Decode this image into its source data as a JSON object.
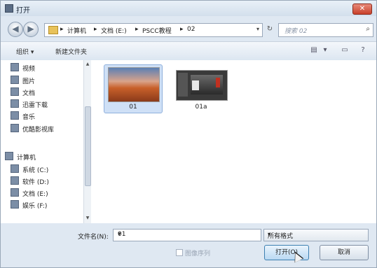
{
  "window": {
    "title": "打开",
    "close_glyph": "✕"
  },
  "address_bar": {
    "back_glyph": "◀",
    "forward_glyph": "▶",
    "breadcrumbs": [
      "计算机",
      "文档 (E:)",
      "PSCC教程",
      "02"
    ],
    "separator": "▸",
    "dropdown_glyph": "▾",
    "refresh_glyph": "↻",
    "search_placeholder": "搜索 02",
    "search_icon_glyph": "⌕"
  },
  "toolbar": {
    "organize_label": "组织 ▾",
    "new_folder_label": "新建文件夹",
    "view_icon_glyph": "▤",
    "view_dropdown_glyph": "▾",
    "preview_icon_glyph": "▭",
    "help_icon_glyph": "?"
  },
  "navigation": {
    "libraries": [
      "视频",
      "图片",
      "文档",
      "迅雷下载",
      "音乐",
      "优酷影视库"
    ],
    "computer_label": "计算机",
    "drives": [
      "系统 (C:)",
      "软件 (D:)",
      "文档 (E:)",
      "娱乐 (F:)"
    ],
    "scroll_up_glyph": "▲",
    "scroll_down_glyph": "▼"
  },
  "files": [
    {
      "name": "01",
      "selected": true
    },
    {
      "name": "01a",
      "selected": false
    }
  ],
  "bottom": {
    "filename_label": "文件名(N):",
    "filename_value": "01",
    "filename_dropdown_glyph": "▾",
    "filter_value": "所有格式",
    "filter_dropdown_glyph": "▾",
    "image_sequence_label": "图像序列",
    "open_button_label": "打开(O)",
    "cancel_button_label": "取消"
  },
  "colors": {
    "accent": "#3c7fb1",
    "selection": "#cfe0f6"
  }
}
